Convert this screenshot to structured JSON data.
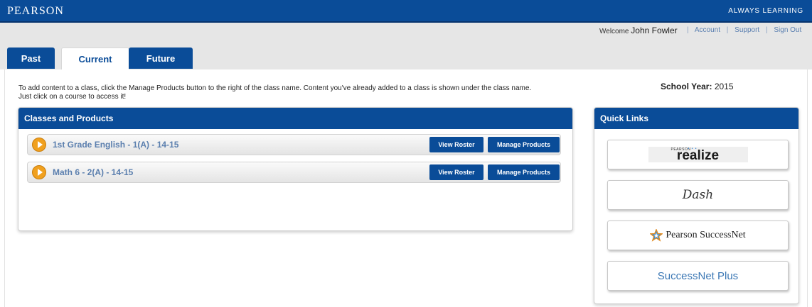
{
  "header": {
    "brand": "PEARSON",
    "tagline": "ALWAYS LEARNING"
  },
  "user": {
    "welcome_label": "Welcome",
    "name": "John Fowler",
    "links": [
      "Account",
      "Support",
      "Sign Out"
    ]
  },
  "tabs": [
    {
      "label": "Past",
      "active": false
    },
    {
      "label": "Current",
      "active": true
    },
    {
      "label": "Future",
      "active": false
    }
  ],
  "instructions": {
    "line1": "To add content to a class, click the Manage Products button to the right of the class name. Content you've already added to a class is shown under the class name.",
    "line2": "Just click on a course to access it!"
  },
  "school_year": {
    "label": "School Year:",
    "value": "2015"
  },
  "classes_panel": {
    "title": "Classes and Products",
    "classes": [
      {
        "name": "1st Grade English - 1(A) - 14-15",
        "roster_label": "View Roster",
        "manage_label": "Manage Products"
      },
      {
        "name": "Math 6 - 2(A) - 14-15",
        "roster_label": "View Roster",
        "manage_label": "Manage Products"
      }
    ]
  },
  "quick_links": {
    "title": "Quick Links",
    "items": [
      {
        "name": "realize",
        "small_text": "PEARSON"
      },
      {
        "name": "Dash"
      },
      {
        "name": "Pearson SuccessNet"
      },
      {
        "name": "SuccessNet Plus"
      }
    ]
  },
  "colors": {
    "brand_blue": "#0a4c98",
    "play_orange": "#f0a01e",
    "class_link": "#5b7fae"
  }
}
